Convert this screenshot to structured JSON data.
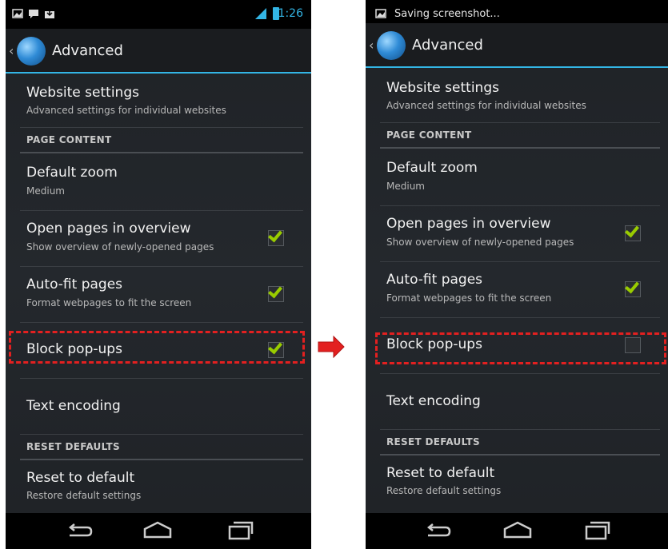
{
  "left": {
    "statusbar": {
      "time": "1:26"
    },
    "actionbar": {
      "title": "Advanced"
    },
    "items": [
      {
        "title": "Website settings",
        "subtitle": "Advanced settings for individual websites"
      },
      {
        "section": "PAGE CONTENT"
      },
      {
        "title": "Default zoom",
        "subtitle": "Medium"
      },
      {
        "title": "Open pages in overview",
        "subtitle": "Show overview of newly-opened pages",
        "checked": true
      },
      {
        "title": "Auto-fit pages",
        "subtitle": "Format webpages to fit the screen",
        "checked": true
      },
      {
        "title": "Block pop-ups",
        "checked": true
      },
      {
        "title": "Text encoding"
      },
      {
        "section": "RESET DEFAULTS"
      },
      {
        "title": "Reset to default",
        "subtitle": "Restore default settings"
      }
    ]
  },
  "right": {
    "statusbar": {
      "notification": "Saving screenshot..."
    },
    "actionbar": {
      "title": "Advanced"
    },
    "items": [
      {
        "title": "Website settings",
        "subtitle": "Advanced settings for individual websites"
      },
      {
        "section": "PAGE CONTENT"
      },
      {
        "title": "Default zoom",
        "subtitle": "Medium"
      },
      {
        "title": "Open pages in overview",
        "subtitle": "Show overview of newly-opened pages",
        "checked": true
      },
      {
        "title": "Auto-fit pages",
        "subtitle": "Format webpages to fit the screen",
        "checked": true
      },
      {
        "title": "Block pop-ups",
        "checked": false
      },
      {
        "title": "Text encoding"
      },
      {
        "section": "RESET DEFAULTS"
      },
      {
        "title": "Reset to default",
        "subtitle": "Restore default settings"
      }
    ]
  },
  "colors": {
    "accent": "#33b5e5",
    "check": "#99cc00",
    "highlight": "#e32020"
  }
}
